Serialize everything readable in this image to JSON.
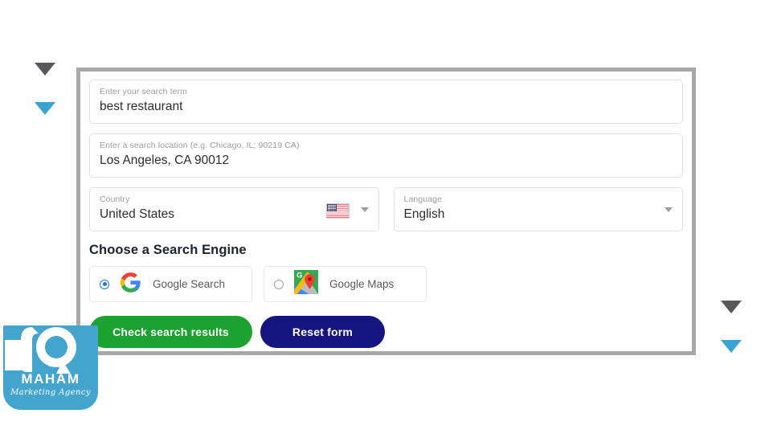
{
  "decor": {
    "triangles": [
      {
        "name": "triangle-top-left-dark",
        "color": "#58585a"
      },
      {
        "name": "triangle-top-left-blue",
        "color": "#3ba2d4"
      },
      {
        "name": "triangle-bottom-right-dark",
        "color": "#58585a"
      },
      {
        "name": "triangle-bottom-right-blue",
        "color": "#3ba2d4"
      }
    ]
  },
  "form": {
    "search_term": {
      "label": "Enter your search term",
      "value": "best restaurant",
      "placeholder": "Enter your search term"
    },
    "search_location": {
      "label": "Enter a search location (e.g. Chicago, IL; 90219 CA)",
      "value": "Los Angeles, CA 90012",
      "placeholder": "Enter a search location (e.g. Chicago, IL; 90219 CA)"
    },
    "country": {
      "label": "Country",
      "value": "United States",
      "flag_icon": "us-flag-icon",
      "caret_icon": "chevron-down-icon"
    },
    "language": {
      "label": "Language",
      "value": "English",
      "caret_icon": "chevron-down-icon"
    },
    "engine_section": {
      "title": "Choose a Search Engine",
      "options": [
        {
          "label": "Google Search",
          "icon": "google-g-icon",
          "selected": true
        },
        {
          "label": "Google Maps",
          "icon": "google-maps-icon",
          "selected": false
        }
      ]
    },
    "buttons": {
      "submit": {
        "label": "Check search results",
        "color": "#1ca32f"
      },
      "reset": {
        "label": "Reset form",
        "color": "#161580"
      }
    }
  },
  "logo": {
    "name": "MAHAM",
    "tagline": "Marketing Agency",
    "color": "#43a5cd"
  }
}
